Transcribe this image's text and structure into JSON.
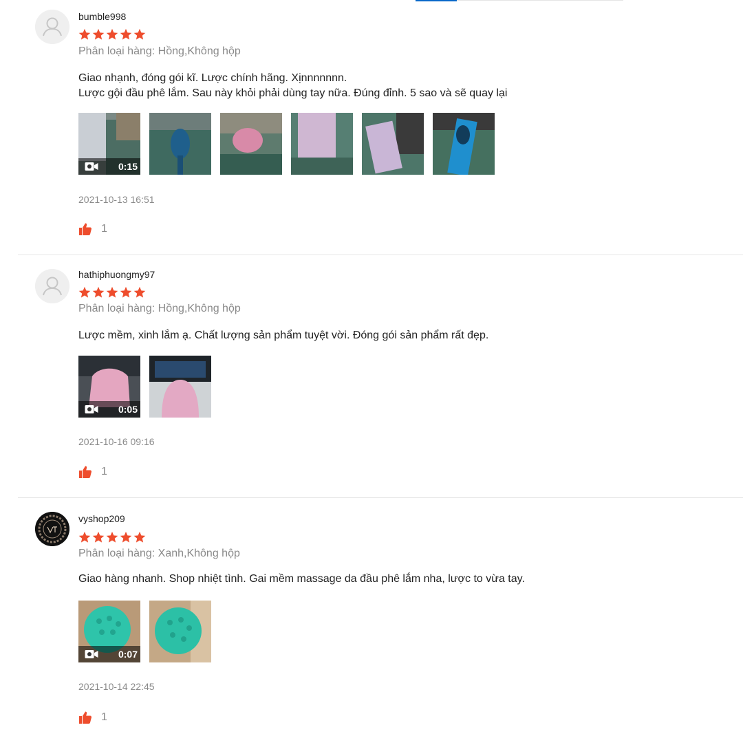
{
  "colors": {
    "star": "#ee4d2d",
    "like": "#ee4d2d",
    "muted": "#8a8a8a",
    "tab_active": "#0a68c9"
  },
  "icons": {
    "rating": "star-icon",
    "video": "video-camera-icon",
    "like": "thumbs-up-icon",
    "avatar_default": "user-silhouette-icon"
  },
  "reviews": [
    {
      "username": "bumble998",
      "rating": 5,
      "variation": "Phân loại hàng: Hồng,Không hộp",
      "comment_lines": [
        "Giao nhạnh, đóng gói kĩ. Lược chính hãng. Xịnnnnnnn.",
        "Lược gội đầu phê lắm. Sau này khỏi phải dùng tay nữa. Đúng đỉnh. 5 sao và sẽ quay lại"
      ],
      "video_duration": "0:15",
      "media_count": 6,
      "date": "2021-10-13 16:51",
      "likes": "1"
    },
    {
      "username": "hathiphuongmy97",
      "rating": 5,
      "variation": "Phân loại hàng: Hồng,Không hộp",
      "comment_lines": [
        "Lược mềm, xinh lắm ạ. Chất lượng sản phẩm tuyệt vời. Đóng gói sản phẩm rất đẹp."
      ],
      "video_duration": "0:05",
      "media_count": 2,
      "date": "2021-10-16 09:16",
      "likes": "1"
    },
    {
      "username": "vyshop209",
      "rating": 5,
      "variation": "Phân loại hàng: Xanh,Không hộp",
      "comment_lines": [
        "Giao hàng nhanh. Shop nhiệt tình. Gai mềm massage da đầu phê lắm nha, lược to vừa tay."
      ],
      "video_duration": "0:07",
      "media_count": 2,
      "date": "2021-10-14 22:45",
      "likes": "1"
    }
  ]
}
